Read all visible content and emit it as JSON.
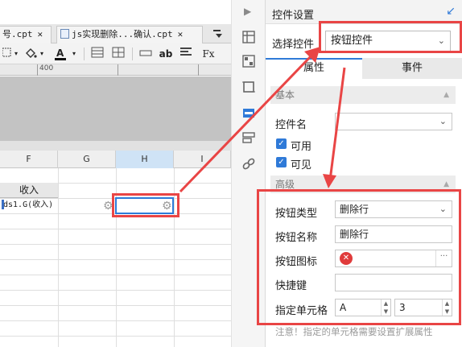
{
  "designer": {
    "file_tabs": [
      {
        "label": "号.cpt",
        "close": "✕"
      },
      {
        "label": "js实现删除...确认.cpt",
        "close": "✕"
      }
    ],
    "tabs_more_icon": "menu-icon",
    "toolbar": {
      "italic_label": "Fx"
    },
    "ruler": {
      "tick_label": "400"
    },
    "columns": [
      "F",
      "G",
      "H",
      "I"
    ],
    "selected_column": "H",
    "cells": {
      "header_text": "收入",
      "formula_text": "ds1.G(收入)"
    }
  },
  "panel": {
    "title": "控件设置",
    "select_label": "选择控件",
    "select_value": "按钮控件",
    "tabs": {
      "attributes": "属性",
      "events": "事件"
    },
    "section_basic": "基本",
    "widget_name_label": "控件名",
    "widget_name_value": "",
    "visible_checkbox": "可用",
    "enabled_checkbox": "可见",
    "section_advanced": "高级",
    "button_type_label": "按钮类型",
    "button_type_value": "删除行",
    "button_name_label": "按钮名称",
    "button_name_value": "删除行",
    "button_icon_label": "按钮图标",
    "shortcut_label": "快捷键",
    "shortcut_value": "",
    "target_cell_label": "指定单元格",
    "target_col_value": "A",
    "target_row_value": "3",
    "note": "注意！指定的单元格需要设置扩展属性"
  },
  "colors": {
    "accent": "#2f7ad8",
    "highlight": "#e94545",
    "selected_col": "#cfe3f6"
  }
}
